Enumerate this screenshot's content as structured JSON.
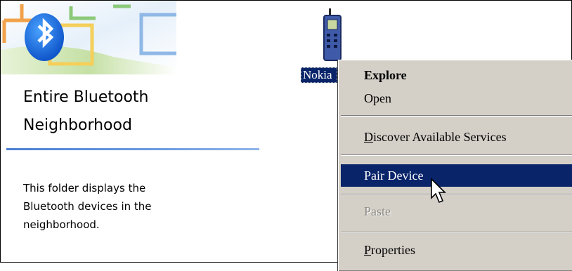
{
  "task_pane": {
    "title_line1": "Entire Bluetooth",
    "title_line2": "Neighborhood",
    "desc_line1": "This folder displays the",
    "desc_line2": "Bluetooth devices in the",
    "desc_line3": "neighborhood.",
    "header_icon": "bluetooth-icon",
    "accent_color": "#1a6fd8"
  },
  "device": {
    "label": "Nokia",
    "icon": "mobile-phone-icon"
  },
  "context_menu": {
    "explore": "Explore",
    "open": "Open",
    "discover_accel": "D",
    "discover_rest": "iscover Available Services",
    "pair": "Pair Device",
    "paste": "Paste",
    "properties_accel": "P",
    "properties_rest": "roperties",
    "selected_item": "Pair Device",
    "highlight_color": "#0a246a",
    "menu_bg_color": "#d4d0c8"
  },
  "cursor": {
    "icon": "arrow-cursor-icon"
  }
}
